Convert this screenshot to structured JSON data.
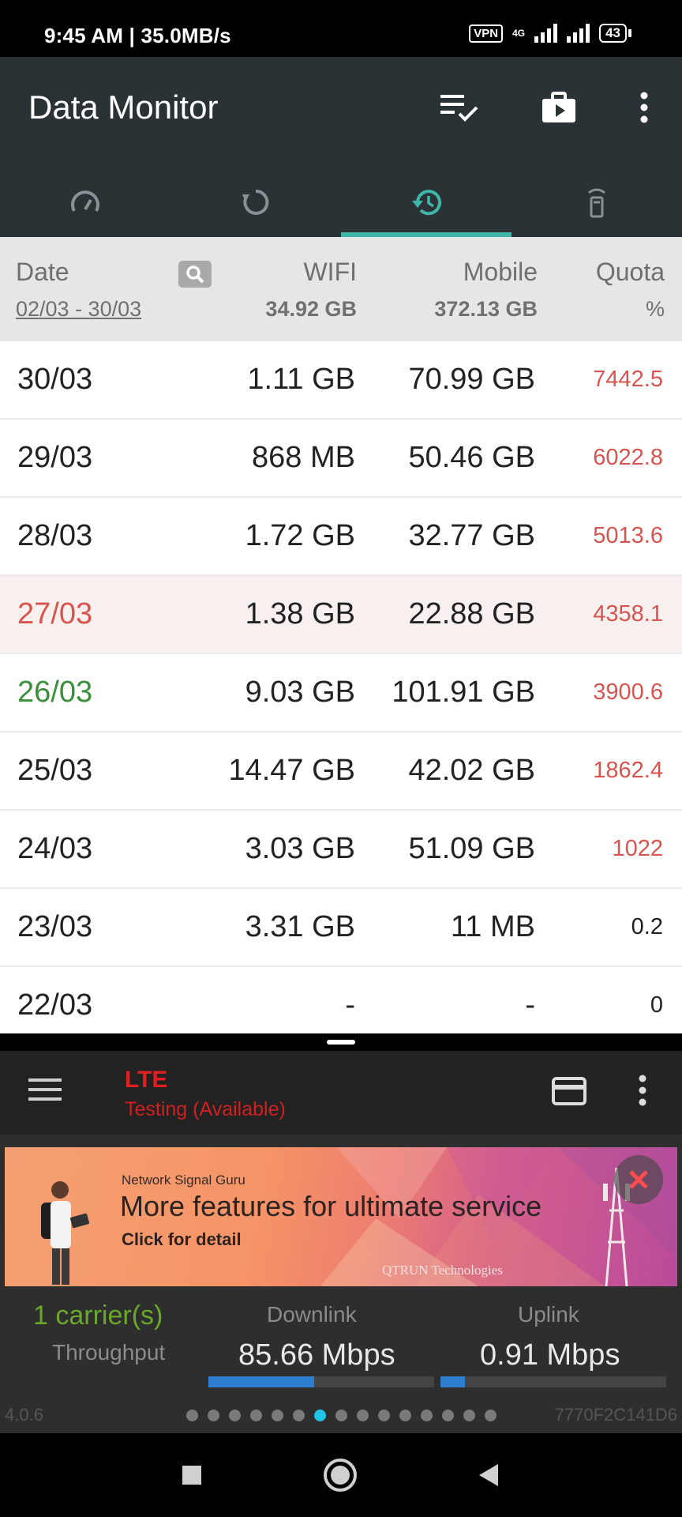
{
  "status": {
    "time_speed": "9:45 AM | 35.0MB/s",
    "vpn": "VPN",
    "network": "4G",
    "battery": "43"
  },
  "app": {
    "title": "Data Monitor",
    "tabs": [
      {
        "icon": "speedometer-icon",
        "active": false
      },
      {
        "icon": "refresh-circle-icon",
        "active": false
      },
      {
        "icon": "history-icon",
        "active": true
      },
      {
        "icon": "wifi-device-icon",
        "active": false
      }
    ],
    "accent": "#3fb6a8"
  },
  "table": {
    "headers": {
      "date": "Date",
      "wifi": "WIFI",
      "mobile": "Mobile",
      "quota": "Quota"
    },
    "summary": {
      "date_range": "02/03 - 30/03",
      "wifi_total": "34.92 GB",
      "mobile_total": "372.13 GB",
      "quota_unit": "%"
    },
    "rows": [
      {
        "date": "30/03",
        "wifi": "1.11 GB",
        "mobile": "70.99 GB",
        "quota": "7442.5",
        "date_color": "#222",
        "quota_color": "#d9534f"
      },
      {
        "date": "29/03",
        "wifi": "868 MB",
        "mobile": "50.46 GB",
        "quota": "6022.8",
        "date_color": "#222",
        "quota_color": "#d9534f"
      },
      {
        "date": "28/03",
        "wifi": "1.72 GB",
        "mobile": "32.77 GB",
        "quota": "5013.6",
        "date_color": "#222",
        "quota_color": "#d9534f"
      },
      {
        "date": "27/03",
        "wifi": "1.38 GB",
        "mobile": "22.88 GB",
        "quota": "4358.1",
        "date_color": "#d9534f",
        "quota_color": "#d9534f",
        "highlight": true
      },
      {
        "date": "26/03",
        "wifi": "9.03 GB",
        "mobile": "101.91 GB",
        "quota": "3900.6",
        "date_color": "#3a8f3a",
        "quota_color": "#d9534f"
      },
      {
        "date": "25/03",
        "wifi": "14.47 GB",
        "mobile": "42.02 GB",
        "quota": "1862.4",
        "date_color": "#222",
        "quota_color": "#d9534f"
      },
      {
        "date": "24/03",
        "wifi": "3.03 GB",
        "mobile": "51.09 GB",
        "quota": "1022",
        "date_color": "#222",
        "quota_color": "#d9534f"
      },
      {
        "date": "23/03",
        "wifi": "3.31 GB",
        "mobile": "11 MB",
        "quota": "0.2",
        "date_color": "#222",
        "quota_color": "#222"
      },
      {
        "date": "22/03",
        "wifi": "-",
        "mobile": "-",
        "quota": "0",
        "date_color": "#222",
        "quota_color": "#222"
      }
    ]
  },
  "nsg": {
    "title": "LTE",
    "subtitle": "Testing (Available)",
    "banner": {
      "small": "Network Signal Guru",
      "headline": "More features for ultimate service",
      "cta": "Click for detail",
      "brand": "QTRUN Technologies"
    },
    "carrier": "1 carrier(s)",
    "throughput_label": "Throughput",
    "downlink_label": "Downlink",
    "uplink_label": "Uplink",
    "downlink_value": "85.66 Mbps",
    "uplink_value": "0.91 Mbps",
    "downlink_level": 0.47,
    "uplink_level": 0.11,
    "version": "4.0.6",
    "device_id": "7770F2C141D6",
    "page_count": 15,
    "page_active": 6
  }
}
